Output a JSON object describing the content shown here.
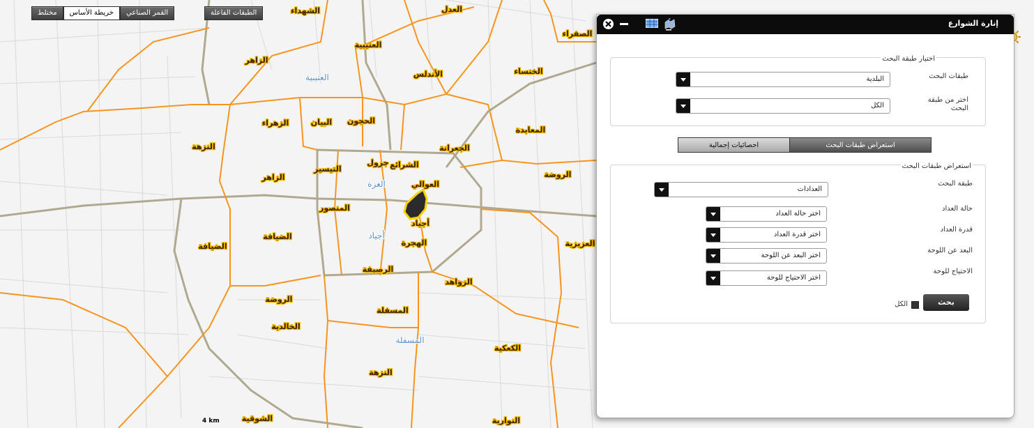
{
  "toolbar_right": {
    "active_layers": "الطبقات الفاعلة"
  },
  "toolbar_left": {
    "satellite": "القمر الصناعي",
    "base_map": "خريطة الأساس",
    "mixed": "مختلط"
  },
  "map": {
    "scale_text": "4 km",
    "district_labels": [
      "الشهداء",
      "الصفراء",
      "العتيبية",
      "الزاهر",
      "الأندلس",
      "الخنساء",
      "المعابدة",
      "الزهراء",
      "النزهة",
      "العدل",
      "الحجون",
      "الجعرانة",
      "البيان",
      "التيسير",
      "الزاهر",
      "المنصور",
      "المسفلة",
      "أجياد",
      "الروضة",
      "الضيافة",
      "الضيافة",
      "الروضة",
      "العزيزية",
      "جرول",
      "الزواهد",
      "الهجرة",
      "الشوقية",
      "الخالدية",
      "النزهة",
      "العوالي",
      "الشرائع",
      "الكعكية",
      "الرصيفة",
      "النوارية"
    ],
    "blue_labels": [
      "العتيبية",
      "الغزة",
      "أجياد",
      "المسفلة"
    ]
  },
  "panel": {
    "title": "إنارة الشوارع",
    "icons": [
      "close-icon",
      "minimize-icon",
      "table-icon",
      "map-pin-icon"
    ],
    "search_layer_section": {
      "legend": "اختيار طبقة البحث",
      "layers_label": "طبقات البحث",
      "layers_value": "البلدية",
      "choose_label": "اختر من طبقة البحث",
      "choose_value": "الكل"
    },
    "tabs": {
      "browse": "استعراض طبقات البحث",
      "stats": "احصائيات إجمالية"
    },
    "browse_section": {
      "legend": "استعراض طبقات البحث",
      "layer_label": "طبقة البحث",
      "layer_value": "العدادات",
      "status_label": "حالة العداد",
      "status_placeholder": "اختر حالة العداد",
      "capacity_label": "قدرة العداد",
      "capacity_placeholder": "اختر قدرة العداد",
      "distance_label": "البعد عن اللوحة",
      "distance_placeholder": "اختر البعد عن اللوحة",
      "need_label": "الاحتياج للوحة",
      "need_placeholder": "اختر الاحتياج للوحة",
      "all_label": "الكل",
      "search_button": "بحث"
    }
  }
}
